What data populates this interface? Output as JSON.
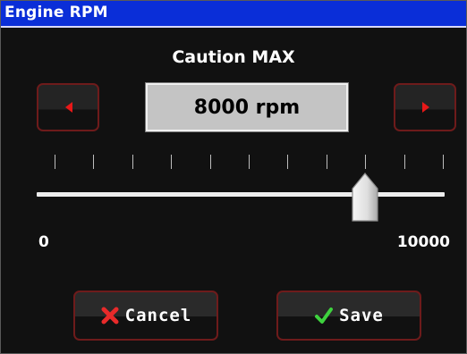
{
  "window": {
    "title": "Engine RPM"
  },
  "setting": {
    "label": "Caution MAX",
    "value_display": "8000 rpm",
    "value": 8000,
    "min": 0,
    "max": 10000,
    "min_label": "0",
    "max_label": "10000",
    "tick_count": 11,
    "unit": "rpm"
  },
  "buttons": {
    "decrease_icon": "left-arrow-icon",
    "increase_icon": "right-arrow-icon",
    "cancel_label": "Cancel",
    "cancel_icon": "x-icon",
    "save_label": "Save",
    "save_icon": "checkmark-icon"
  },
  "colors": {
    "titlebar": "#0a2ed8",
    "background": "#111111",
    "button_border": "#6e1b1b",
    "arrow": "#e81818",
    "cancel_icon": "#e82a2a",
    "save_icon": "#3ed23e"
  }
}
